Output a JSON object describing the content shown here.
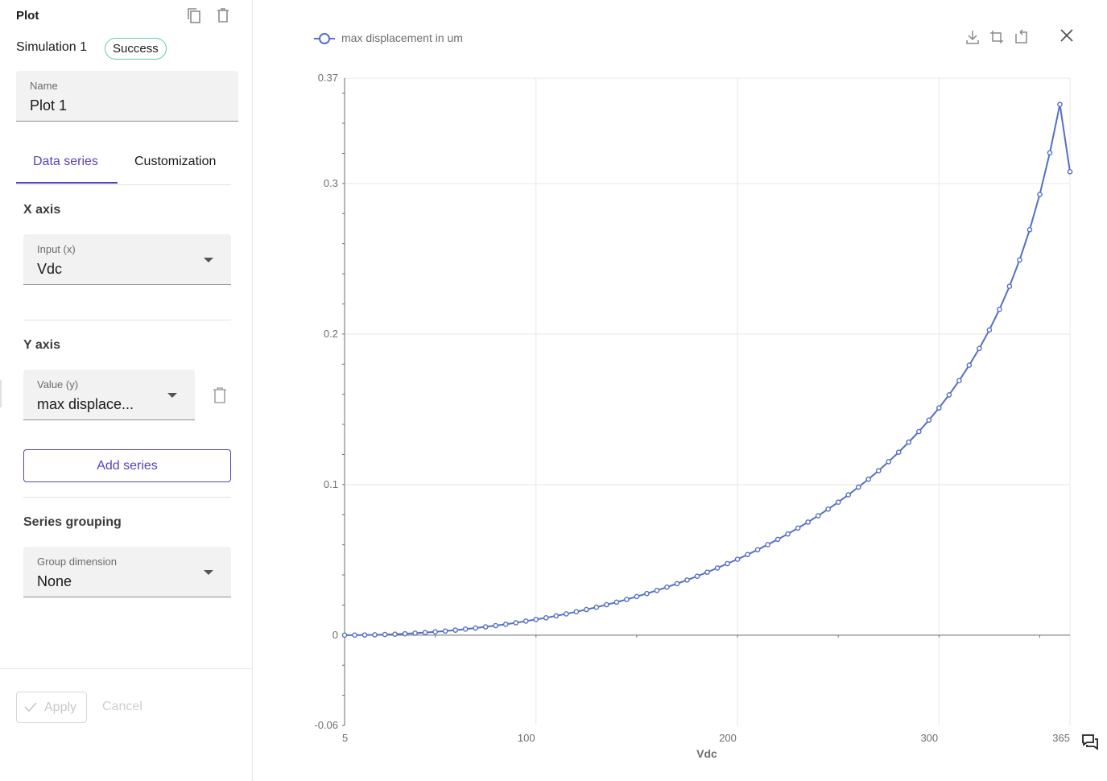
{
  "panel": {
    "title": "Plot",
    "simulation_name": "Simulation 1",
    "status": "Success",
    "name_field": {
      "label": "Name",
      "value": "Plot 1"
    },
    "tabs": [
      {
        "label": "Data series",
        "active": true
      },
      {
        "label": "Customization",
        "active": false
      }
    ],
    "x_axis": {
      "title": "X axis",
      "input": {
        "label": "Input (x)",
        "value": "Vdc"
      }
    },
    "y_axis": {
      "title": "Y axis",
      "value": {
        "label": "Value (y)",
        "value": "max displace..."
      }
    },
    "add_series_label": "Add series",
    "grouping": {
      "title": "Series grouping",
      "dimension": {
        "label": "Group dimension",
        "value": "None"
      }
    },
    "apply_label": "Apply",
    "cancel_label": "Cancel"
  },
  "colors": {
    "accent": "#5a3fc0",
    "series": "#5470c6",
    "success_border": "#5fcf98"
  },
  "icons": [
    "copy-icon",
    "delete-icon",
    "download-icon",
    "zoom-select-icon",
    "zoom-reset-icon",
    "close-icon",
    "feedback-icon"
  ],
  "chart_data": {
    "type": "line",
    "xlabel": "Vdc",
    "ylabel": "",
    "xlim": [
      5,
      365
    ],
    "ylim": [
      -0.06,
      0.37
    ],
    "x_ticks": [
      5,
      100,
      200,
      300,
      365
    ],
    "y_ticks": [
      -0.06,
      0,
      0.1,
      0.2,
      0.3,
      0.37
    ],
    "x_tick_labels": [
      "5",
      "100",
      "200",
      "300",
      "365"
    ],
    "y_tick_labels": [
      "-0.06",
      "0",
      "0.1",
      "0.2",
      "0.3",
      "0.37"
    ],
    "grid": true,
    "legend": "top-left",
    "series": [
      {
        "name": "max displacement in um",
        "x": [
          5,
          10,
          15,
          20,
          25,
          30,
          35,
          40,
          45,
          50,
          55,
          60,
          65,
          70,
          75,
          80,
          85,
          90,
          95,
          100,
          105,
          110,
          115,
          120,
          125,
          130,
          135,
          140,
          145,
          150,
          155,
          160,
          165,
          170,
          175,
          180,
          185,
          190,
          195,
          200,
          205,
          210,
          215,
          220,
          225,
          230,
          235,
          240,
          245,
          250,
          255,
          260,
          265,
          270,
          275,
          280,
          285,
          290,
          295,
          300,
          305,
          310,
          315,
          320,
          325,
          330,
          335,
          340,
          345,
          350,
          355,
          360,
          365
        ],
        "y": [
          0,
          0,
          0.0001,
          0.0002,
          0.0004,
          0.0006,
          0.0009,
          0.0013,
          0.0017,
          0.0022,
          0.0027,
          0.0033,
          0.004,
          0.0047,
          0.0055,
          0.0063,
          0.0072,
          0.0082,
          0.0093,
          0.0104,
          0.0115,
          0.0128,
          0.0141,
          0.0155,
          0.017,
          0.0185,
          0.0202,
          0.0219,
          0.0237,
          0.0256,
          0.0276,
          0.0297,
          0.0319,
          0.0342,
          0.0366,
          0.0391,
          0.0418,
          0.0446,
          0.0475,
          0.0504,
          0.0535,
          0.0567,
          0.0601,
          0.0636,
          0.0672,
          0.0711,
          0.0751,
          0.0793,
          0.0837,
          0.0883,
          0.0932,
          0.0983,
          0.1036,
          0.1092,
          0.1152,
          0.1215,
          0.1282,
          0.1352,
          0.1428,
          0.1509,
          0.1596,
          0.169,
          0.1793,
          0.1904,
          0.2027,
          0.2164,
          0.2317,
          0.2492,
          0.2693,
          0.2927,
          0.3204,
          0.3525,
          0.3078
        ]
      }
    ]
  }
}
